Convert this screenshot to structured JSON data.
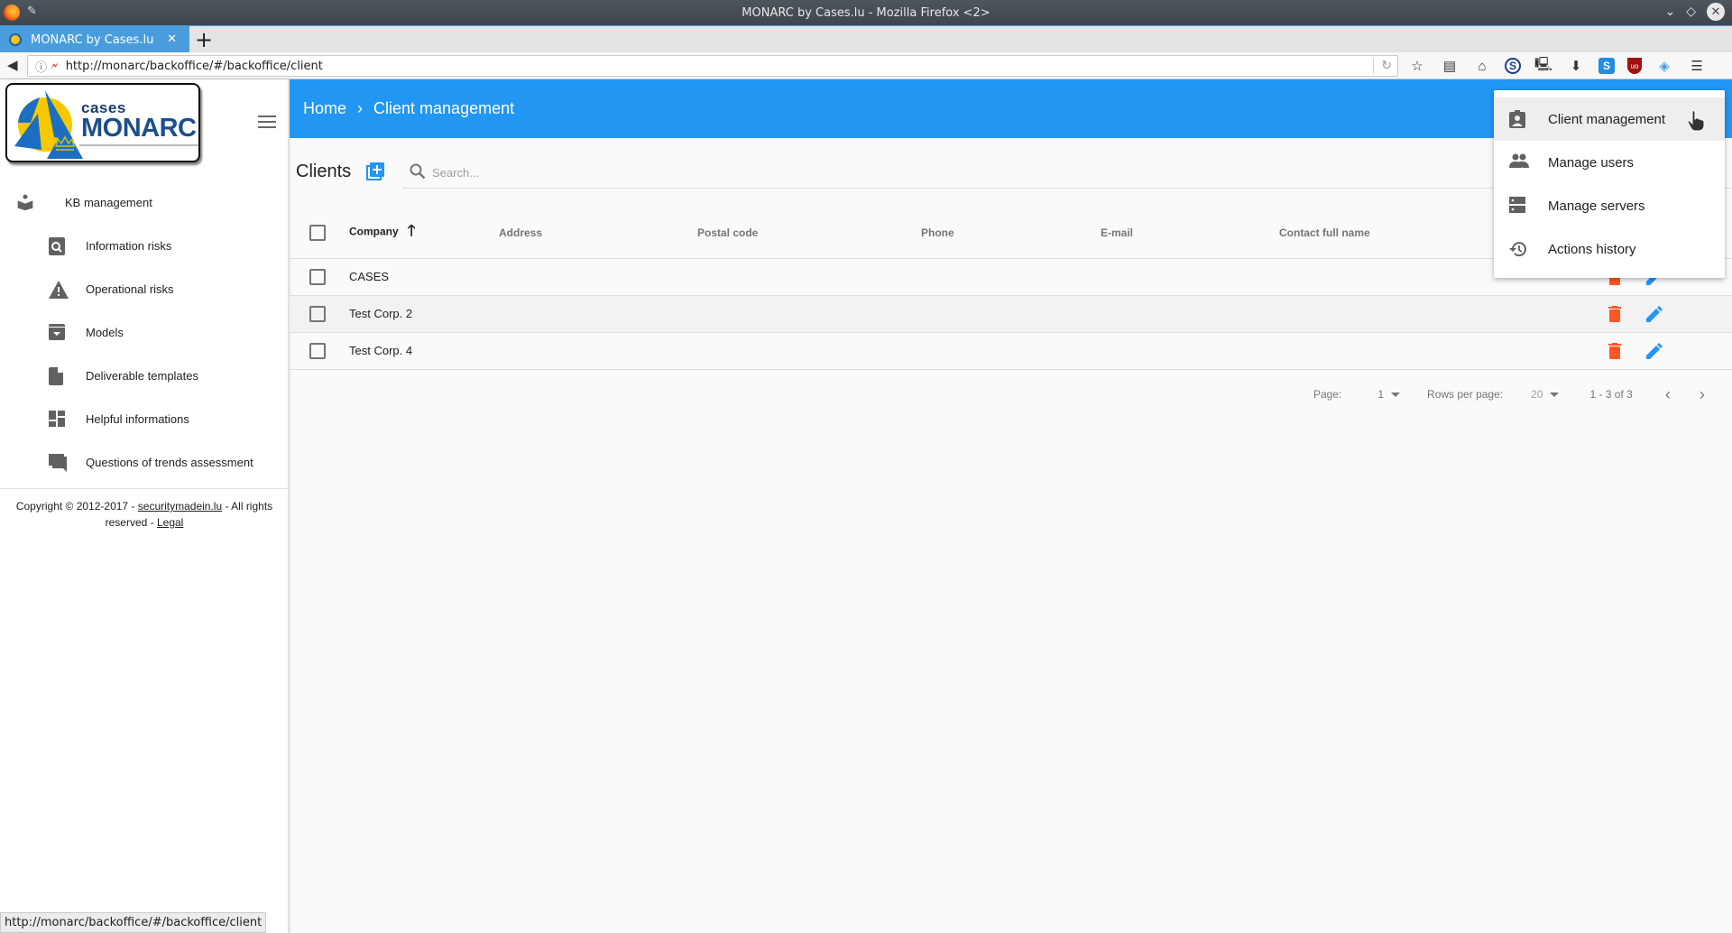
{
  "window": {
    "title": "MONARC by Cases.lu - Mozilla Firefox <2>"
  },
  "browser": {
    "tab_label": "MONARC by Cases.lu",
    "url": "http://monarc/backoffice/#/backoffice/client",
    "status_url": "http://monarc/backoffice/#/backoffice/client",
    "toolbar_icons": [
      "bookmark-star-icon",
      "reading-list-icon",
      "home-icon",
      "s-extension-icon",
      "network-icon",
      "download-icon",
      "s-blue-extension-icon",
      "ublock-icon",
      "diamond-extension-icon",
      "menu-icon"
    ]
  },
  "logo": {
    "line1": "cases",
    "line2": "MONARC"
  },
  "sidebar": {
    "section": {
      "label": "KB management",
      "icon": "kb-icon"
    },
    "items": [
      {
        "label": "Information risks",
        "icon": "search-doc-icon"
      },
      {
        "label": "Operational risks",
        "icon": "warning-icon"
      },
      {
        "label": "Models",
        "icon": "archive-icon"
      },
      {
        "label": "Deliverable templates",
        "icon": "file-icon"
      },
      {
        "label": "Helpful informations",
        "icon": "dashboard-icon"
      },
      {
        "label": "Questions of trends assessment",
        "icon": "forum-icon"
      }
    ],
    "copyright": {
      "prefix": "Copyright © 2012-2017 - ",
      "link": "securitymadein.lu",
      "middle": " - All rights reserved - ",
      "legal": "Legal"
    }
  },
  "header": {
    "breadcrumb": [
      "Home",
      "Client management"
    ],
    "separator": "›"
  },
  "clients": {
    "title": "Clients",
    "search_placeholder": "Search...",
    "search_value": "",
    "columns": [
      "Company",
      "Address",
      "Postal code",
      "Phone",
      "E-mail",
      "Contact full name"
    ],
    "sorted_column": "Company",
    "sort_direction": "ascending",
    "rows": [
      {
        "company": "CASES",
        "address": "",
        "postal_code": "",
        "phone": "",
        "email": "",
        "contact": ""
      },
      {
        "company": "Test Corp. 2",
        "address": "",
        "postal_code": "",
        "phone": "",
        "email": "",
        "contact": ""
      },
      {
        "company": "Test Corp. 4",
        "address": "",
        "postal_code": "",
        "phone": "",
        "email": "",
        "contact": ""
      }
    ]
  },
  "pagination": {
    "page_label": "Page:",
    "page_value": "1",
    "rows_label": "Rows per page:",
    "rows_value": "20",
    "range": "1 - 3 of 3"
  },
  "menu": {
    "items": [
      {
        "label": "Client management",
        "icon": "badge-icon",
        "active": true
      },
      {
        "label": "Manage users",
        "icon": "people-icon",
        "active": false
      },
      {
        "label": "Manage servers",
        "icon": "servers-icon",
        "active": false
      },
      {
        "label": "Actions history",
        "icon": "history-icon",
        "active": false
      }
    ]
  },
  "colors": {
    "primary": "#2196f3",
    "delete": "#ff5722",
    "edit": "#2196f3",
    "tab_active": "#4a9ddc"
  }
}
